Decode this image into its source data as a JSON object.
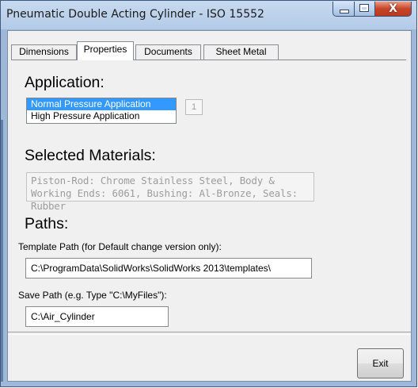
{
  "window": {
    "title": "Pneumatic Double Acting Cylinder - ISO 15552",
    "close_glyph": "X"
  },
  "tabs": [
    {
      "label": "Dimensions",
      "active": false
    },
    {
      "label": "Properties",
      "active": true
    },
    {
      "label": "Documents",
      "active": false
    },
    {
      "label": "Sheet Metal",
      "active": false
    }
  ],
  "application": {
    "heading": "Application:",
    "options": [
      "Normal Pressure Application",
      "High Pressure Application"
    ],
    "selected_index": 0,
    "index_value": "1"
  },
  "materials": {
    "heading": "Selected Materials:",
    "text": "Piston-Rod: Chrome Stainless Steel, Body & Working Ends: 6061, Bushing: Al-Bronze, Seals: Rubber"
  },
  "paths": {
    "heading": "Paths:",
    "template_label": "Template Path (for Default change version only):",
    "template_value": "C:\\ProgramData\\SolidWorks\\SolidWorks 2013\\templates\\",
    "save_label": "Save Path (e.g. Type \"C:\\MyFiles\"):",
    "save_value": "C:\\Air_Cylinder"
  },
  "footer": {
    "exit_label": "Exit"
  },
  "colors": {
    "selection": "#3399ff",
    "close_button": "#c8452a",
    "title_bar": "#b3cbe8"
  }
}
